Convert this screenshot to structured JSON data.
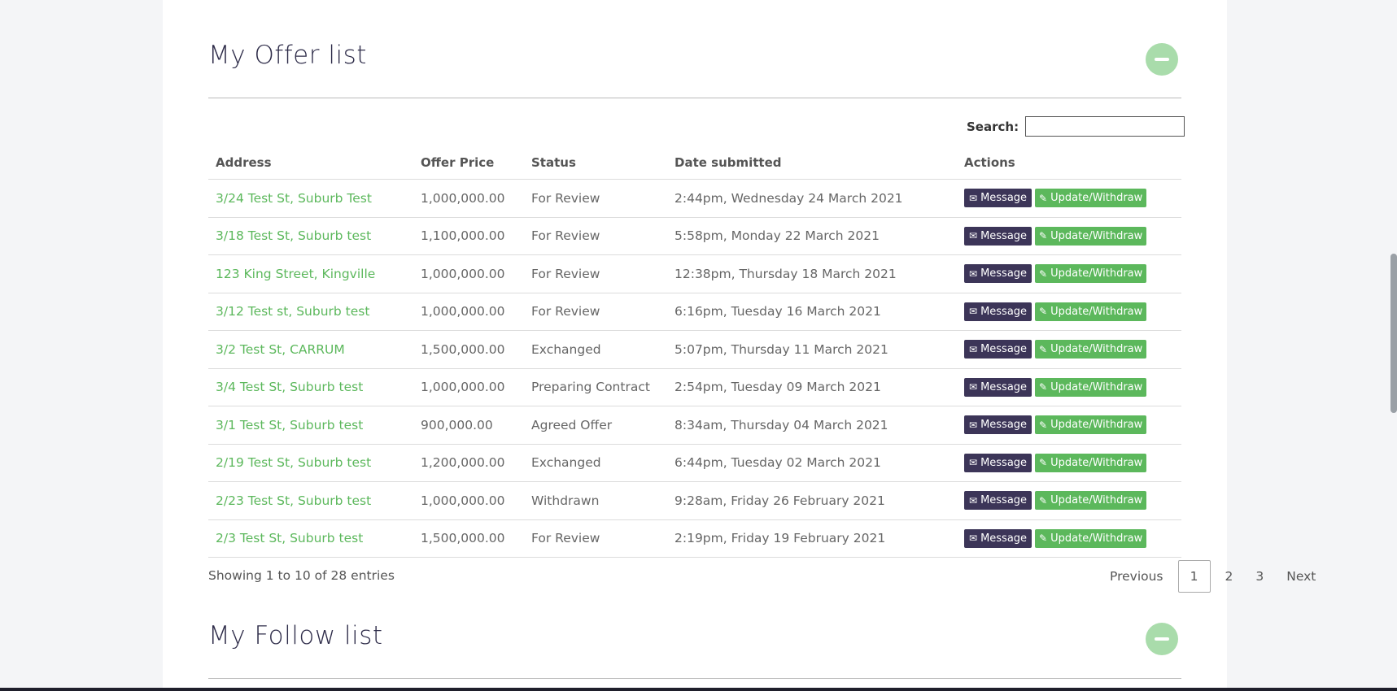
{
  "offer_section": {
    "title": "My Offer list",
    "search_label": "Search:",
    "search_value": "",
    "columns": [
      "Address",
      "Offer Price",
      "Status",
      "Date submitted",
      "Actions"
    ],
    "message_label": "Message",
    "update_label": "Update/Withdraw",
    "rows": [
      {
        "address": "3/24 Test St, Suburb Test",
        "price": "1,000,000.00",
        "status": "For Review",
        "date": "2:44pm, Wednesday 24 March 2021",
        "msg_icon": "envelope-outline-icon",
        "msg_glyph": "✉"
      },
      {
        "address": "3/18 Test St, Suburb test",
        "price": "1,100,000.00",
        "status": "For Review",
        "date": "5:58pm, Monday 22 March 2021",
        "msg_icon": "envelope-open-icon",
        "msg_glyph": "✉"
      },
      {
        "address": "123 King Street, Kingville",
        "price": "1,000,000.00",
        "status": "For Review",
        "date": "12:38pm, Thursday 18 March 2021",
        "msg_icon": "envelope-outline-icon",
        "msg_glyph": "✉"
      },
      {
        "address": "3/12 Test st, Suburb test",
        "price": "1,000,000.00",
        "status": "For Review",
        "date": "6:16pm, Tuesday 16 March 2021",
        "msg_icon": "envelope-filled-icon",
        "msg_glyph": "✉"
      },
      {
        "address": "3/2 Test St, CARRUM",
        "price": "1,500,000.00",
        "status": "Exchanged",
        "date": "5:07pm, Thursday 11 March 2021",
        "msg_icon": "envelope-filled-icon",
        "msg_glyph": "✉"
      },
      {
        "address": "3/4 Test St, Suburb test",
        "price": "1,000,000.00",
        "status": "Preparing Contract",
        "date": "2:54pm, Tuesday 09 March 2021",
        "msg_icon": "envelope-filled-icon",
        "msg_glyph": "✉"
      },
      {
        "address": "3/1 Test St, Suburb test",
        "price": "900,000.00",
        "status": "Agreed Offer",
        "date": "8:34am, Thursday 04 March 2021",
        "msg_icon": "envelope-filled-icon",
        "msg_glyph": "✉"
      },
      {
        "address": "2/19 Test St, Suburb test",
        "price": "1,200,000.00",
        "status": "Exchanged",
        "date": "6:44pm, Tuesday 02 March 2021",
        "msg_icon": "envelope-outline-icon",
        "msg_glyph": "✉"
      },
      {
        "address": "2/23 Test St, Suburb test",
        "price": "1,000,000.00",
        "status": "Withdrawn",
        "date": "9:28am, Friday 26 February 2021",
        "msg_icon": "envelope-outline-icon",
        "msg_glyph": "✉"
      },
      {
        "address": "2/3 Test St, Suburb test",
        "price": "1,500,000.00",
        "status": "For Review",
        "date": "2:19pm, Friday 19 February 2021",
        "msg_icon": "envelope-outline-icon",
        "msg_glyph": "✉"
      }
    ],
    "info": "Showing 1 to 10 of 28 entries",
    "pagination": {
      "previous": "Previous",
      "pages": [
        "1",
        "2",
        "3"
      ],
      "current": "1",
      "next": "Next"
    }
  },
  "follow_section": {
    "title": "My Follow list"
  },
  "colors": {
    "link": "#5cb85c",
    "message_button": "#3c3558",
    "update_button": "#5cb85c",
    "collapse_button": "#a9dcab",
    "title": "#2f2d4a"
  }
}
